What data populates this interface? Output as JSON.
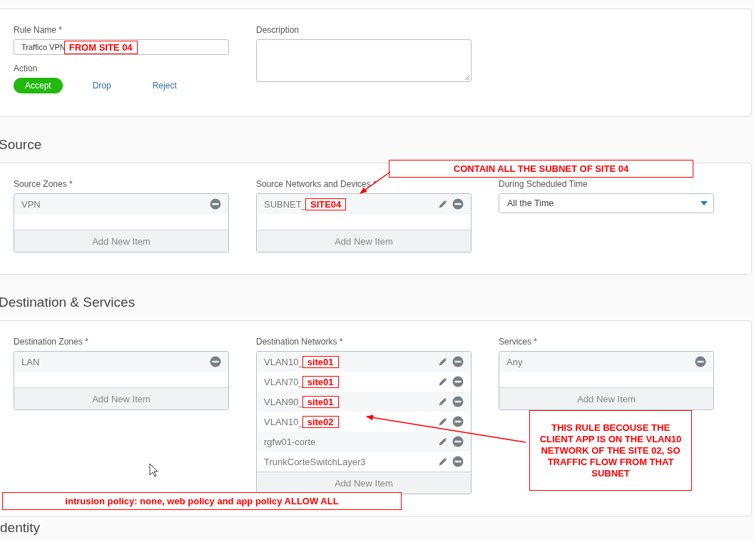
{
  "rule": {
    "name_label": "Rule Name *",
    "name_value": "Traffico VPN",
    "name_note": "FROM SITE 04",
    "description_label": "Description",
    "action_label": "Action",
    "actions": [
      {
        "label": "Accept",
        "selected": true
      },
      {
        "label": "Drop",
        "selected": false
      },
      {
        "label": "Reject",
        "selected": false
      }
    ]
  },
  "sections": [
    {
      "heading": "Source",
      "fields": [
        {
          "kind": "list",
          "label": "Source Zones *",
          "add_label": "Add New Item",
          "items": [
            {
              "text": "VPN",
              "editable": false
            }
          ]
        },
        {
          "kind": "list",
          "label": "Source Networks and Devices *",
          "add_label": "Add New Item",
          "items": [
            {
              "text": "SUBNET_",
              "note": "SITE04",
              "editable": true
            }
          ]
        },
        {
          "kind": "select",
          "label": "During Scheduled Time",
          "value": "All the Time"
        }
      ]
    },
    {
      "heading": "Destination & Services",
      "fields": [
        {
          "kind": "list",
          "label": "Destination Zones *",
          "add_label": "Add New Item",
          "items": [
            {
              "text": "LAN",
              "editable": false
            }
          ]
        },
        {
          "kind": "list",
          "label": "Destination Networks *",
          "add_label": "Add New Item",
          "items": [
            {
              "text": "VLAN10_",
              "note": "site01",
              "editable": true
            },
            {
              "text": "VLAN70_",
              "note": "site01",
              "editable": true
            },
            {
              "text": "VLAN90_",
              "note": "site01",
              "editable": true
            },
            {
              "text": "VLAN10_",
              "note": "site02",
              "editable": true
            },
            {
              "text": "rgfw01-corte",
              "editable": true
            },
            {
              "text": "TrunkCorteSwitchLayer3",
              "editable": true
            }
          ]
        },
        {
          "kind": "list",
          "label": "Services *",
          "add_label": "Add New Item",
          "items": [
            {
              "text": "Any",
              "editable": false
            }
          ]
        }
      ]
    }
  ],
  "next_heading": "dentity",
  "annotations": [
    {
      "text": "CONTAIN ALL THE SUBNET OF SITE 04"
    },
    {
      "text": "THIS RULE BECOUSE THE CLIENT APP IS ON THE VLAN10 NETWORK OF THE SITE 02, SO TRAFFIC FLOW FROM THAT SUBNET"
    },
    {
      "text": "intrusion policy: none, web policy and app policy ALLOW ALL"
    }
  ]
}
